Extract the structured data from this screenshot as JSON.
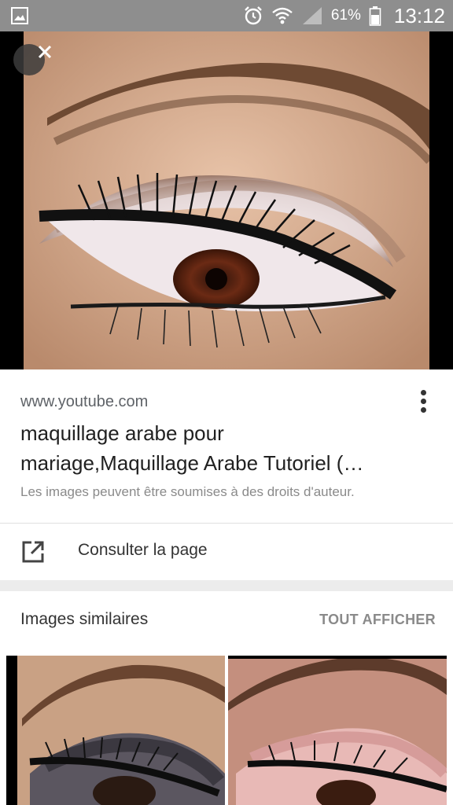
{
  "status_bar": {
    "battery_percent": "61%",
    "time": "13:12",
    "icons": [
      "gallery-icon",
      "alarm-icon",
      "wifi-icon",
      "signal-icon",
      "battery-icon"
    ]
  },
  "viewer": {
    "close_icon": "close-icon"
  },
  "result": {
    "source": "www.youtube.com",
    "title": "maquillage arabe pour mariage,Maquillage Arabe Tutoriel (…",
    "copyright_notice": "Les images peuvent être soumises à des droits d'auteur.",
    "visit_label": "Consulter la page",
    "menu_icon": "more-vert-icon",
    "visit_icon": "open-external-icon"
  },
  "similar": {
    "title": "Images similaires",
    "see_all": "TOUT AFFICHER"
  },
  "colors": {
    "status_bar": "#8e8e8e",
    "text_primary": "#212121",
    "text_secondary": "#5f6368",
    "text_muted": "#8a8a8a"
  }
}
